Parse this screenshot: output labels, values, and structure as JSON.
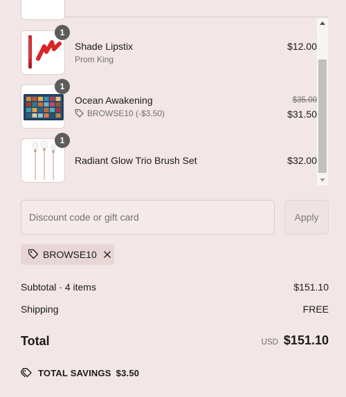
{
  "cart": {
    "items": [
      {
        "name": "Shade Lipstix",
        "variant": "Prom King",
        "quantity": "1",
        "price": "$12.00",
        "original_price": "",
        "discount_label": "",
        "thumbnail_icon": "lipstick-swatch-icon"
      },
      {
        "name": "Ocean Awakening",
        "variant": "",
        "quantity": "1",
        "price": "$31.50",
        "original_price": "$35.00",
        "discount_label": "BROWSE10 (-$3.50)",
        "thumbnail_icon": "eyeshadow-palette-icon"
      },
      {
        "name": "Radiant Glow Trio Brush Set",
        "variant": "",
        "quantity": "1",
        "price": "$32.00",
        "original_price": "",
        "discount_label": "",
        "thumbnail_icon": "brush-set-icon"
      }
    ]
  },
  "discount": {
    "placeholder": "Discount code or gift card",
    "value": "",
    "apply_label": "Apply",
    "applied_code": "BROWSE10"
  },
  "summary": {
    "subtotal_label": "Subtotal · 4 items",
    "subtotal_value": "$151.10",
    "shipping_label": "Shipping",
    "shipping_value": "FREE",
    "total_label": "Total",
    "currency": "USD",
    "total_value": "$151.10",
    "savings_label": "TOTAL SAVINGS",
    "savings_value": "$3.50"
  },
  "colors": {
    "background": "#f2e6e6",
    "badge": "#5c5c5c",
    "chip": "#e8d6d7",
    "text": "#1a1a1a",
    "muted_text": "#707070"
  }
}
